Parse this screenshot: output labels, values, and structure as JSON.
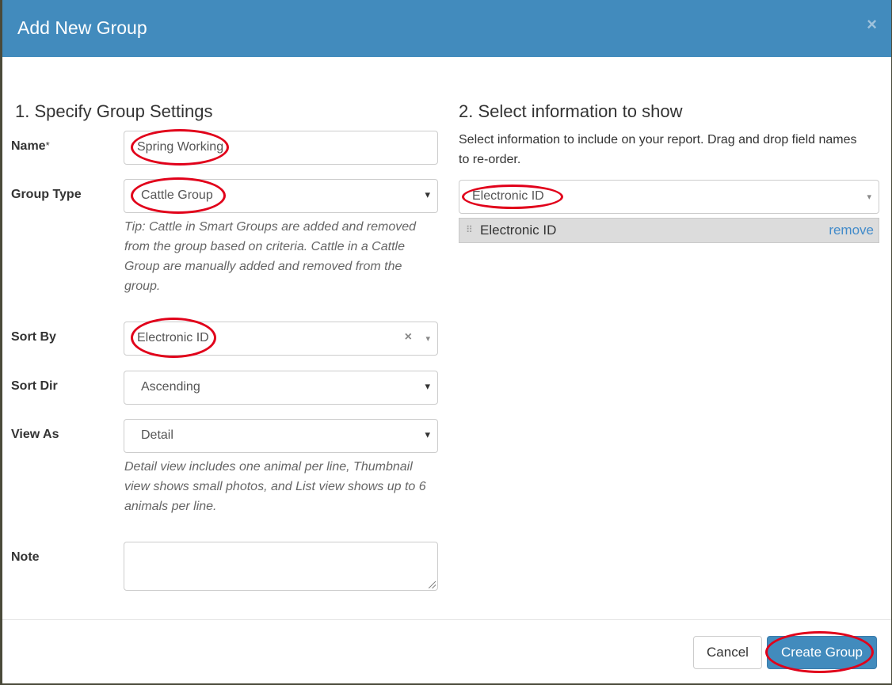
{
  "modal": {
    "title": "Add New Group",
    "close_glyph": "×"
  },
  "left": {
    "section_title": "1. Specify Group Settings",
    "name_label": "Name",
    "name_required": "*",
    "name_value": "Spring Working",
    "group_type_label": "Group Type",
    "group_type_value": "Cattle Group",
    "group_type_tip": "Tip: Cattle in Smart Groups are added and removed from the group based on criteria. Cattle in a Cattle Group are manually added and removed from the group.",
    "sort_by_label": "Sort By",
    "sort_by_value": "Electronic ID",
    "sort_dir_label": "Sort Dir",
    "sort_dir_value": "Ascending",
    "view_as_label": "View As",
    "view_as_value": "Detail",
    "view_as_tip": "Detail view includes one animal per line, Thumbnail view shows small photos, and List view shows up to 6 animals per line.",
    "note_label": "Note",
    "note_value": ""
  },
  "right": {
    "section_title": "2. Select information to show",
    "intro": "Select information to include on your report. Drag and drop field names to re-order.",
    "field_select_value": "Electronic ID",
    "selected_fields": [
      {
        "label": "Electronic ID",
        "remove_label": "remove"
      }
    ]
  },
  "footer": {
    "cancel_label": "Cancel",
    "create_label": "Create Group"
  },
  "colors": {
    "header": "#428bbd",
    "annotation": "#e1001a",
    "link": "#428bca"
  },
  "icons": {
    "caret": "▾",
    "clear": "×",
    "drag": "⠿"
  }
}
